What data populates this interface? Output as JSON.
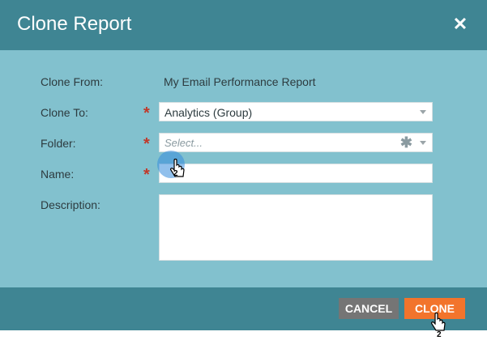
{
  "dialog": {
    "title": "Clone Report",
    "close_icon": "close-icon"
  },
  "form": {
    "clone_from_label": "Clone From:",
    "clone_from_value": "My Email Performance Report",
    "clone_to_label": "Clone To:",
    "clone_to_value": "Analytics (Group)",
    "folder_label": "Folder:",
    "folder_placeholder": "Select...",
    "name_label": "Name:",
    "name_value": "",
    "description_label": "Description:",
    "description_value": "",
    "required_marker": "*"
  },
  "footer": {
    "cancel_label": "CANCEL",
    "clone_label": "CLONE"
  },
  "cursors": {
    "field_cursor_badge": "2",
    "button_cursor_badge": "2"
  },
  "colors": {
    "header_bg": "#3f8593",
    "body_bg": "#82c1ce",
    "cancel_bg": "#757575",
    "clone_bg": "#f2742c",
    "required": "#c0392b"
  }
}
